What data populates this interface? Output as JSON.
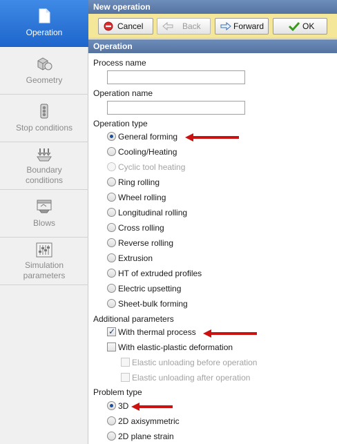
{
  "sidebar": {
    "items": [
      {
        "label": "Operation",
        "icon": "operation-icon",
        "active": true
      },
      {
        "label": "Geometry",
        "icon": "geometry-icon"
      },
      {
        "label": "Stop conditions",
        "icon": "traffic-light-icon"
      },
      {
        "label_line1": "Boundary",
        "label_line2": "conditions",
        "icon": "boundary-conditions-icon"
      },
      {
        "label": "Blows",
        "icon": "anvil-icon"
      },
      {
        "label_line1": "Simulation",
        "label_line2": "parameters",
        "icon": "sliders-icon"
      }
    ]
  },
  "window": {
    "title": "New operation"
  },
  "toolbar": {
    "cancel_label": "Cancel",
    "back_label": "Back",
    "forward_label": "Forward",
    "ok_label": "OK"
  },
  "section": {
    "title": "Operation"
  },
  "form": {
    "process_name_label": "Process name",
    "process_name_value": "",
    "operation_name_label": "Operation name",
    "operation_name_value": "",
    "operation_type_label": "Operation type",
    "operation_types": [
      {
        "label": "General forming",
        "selected": true
      },
      {
        "label": "Cooling/Heating"
      },
      {
        "label": "Cyclic tool heating",
        "disabled": true
      },
      {
        "label": "Ring rolling"
      },
      {
        "label": "Wheel rolling"
      },
      {
        "label": "Longitudinal rolling"
      },
      {
        "label": "Cross rolling"
      },
      {
        "label": "Reverse rolling"
      },
      {
        "label": "Extrusion"
      },
      {
        "label": "HT of extruded profiles"
      },
      {
        "label": "Electric upsetting"
      },
      {
        "label": "Sheet-bulk forming"
      }
    ],
    "additional_label": "Additional parameters",
    "additional": [
      {
        "label": "With thermal process",
        "checked": true
      },
      {
        "label": "With elastic-plastic deformation",
        "checked": false
      },
      {
        "label": "Elastic unloading before operation",
        "disabled": true
      },
      {
        "label": "Elastic unloading after operation",
        "disabled": true
      }
    ],
    "problem_type_label": "Problem type",
    "problem_types": [
      {
        "label": "3D",
        "selected": true
      },
      {
        "label": "2D axisymmetric"
      },
      {
        "label": "2D plane strain"
      }
    ]
  },
  "colors": {
    "accent": "#1e66cc",
    "toolbar": "#f5e79a",
    "header": "#5f7fae",
    "annotation_arrow": "#cc1111"
  }
}
